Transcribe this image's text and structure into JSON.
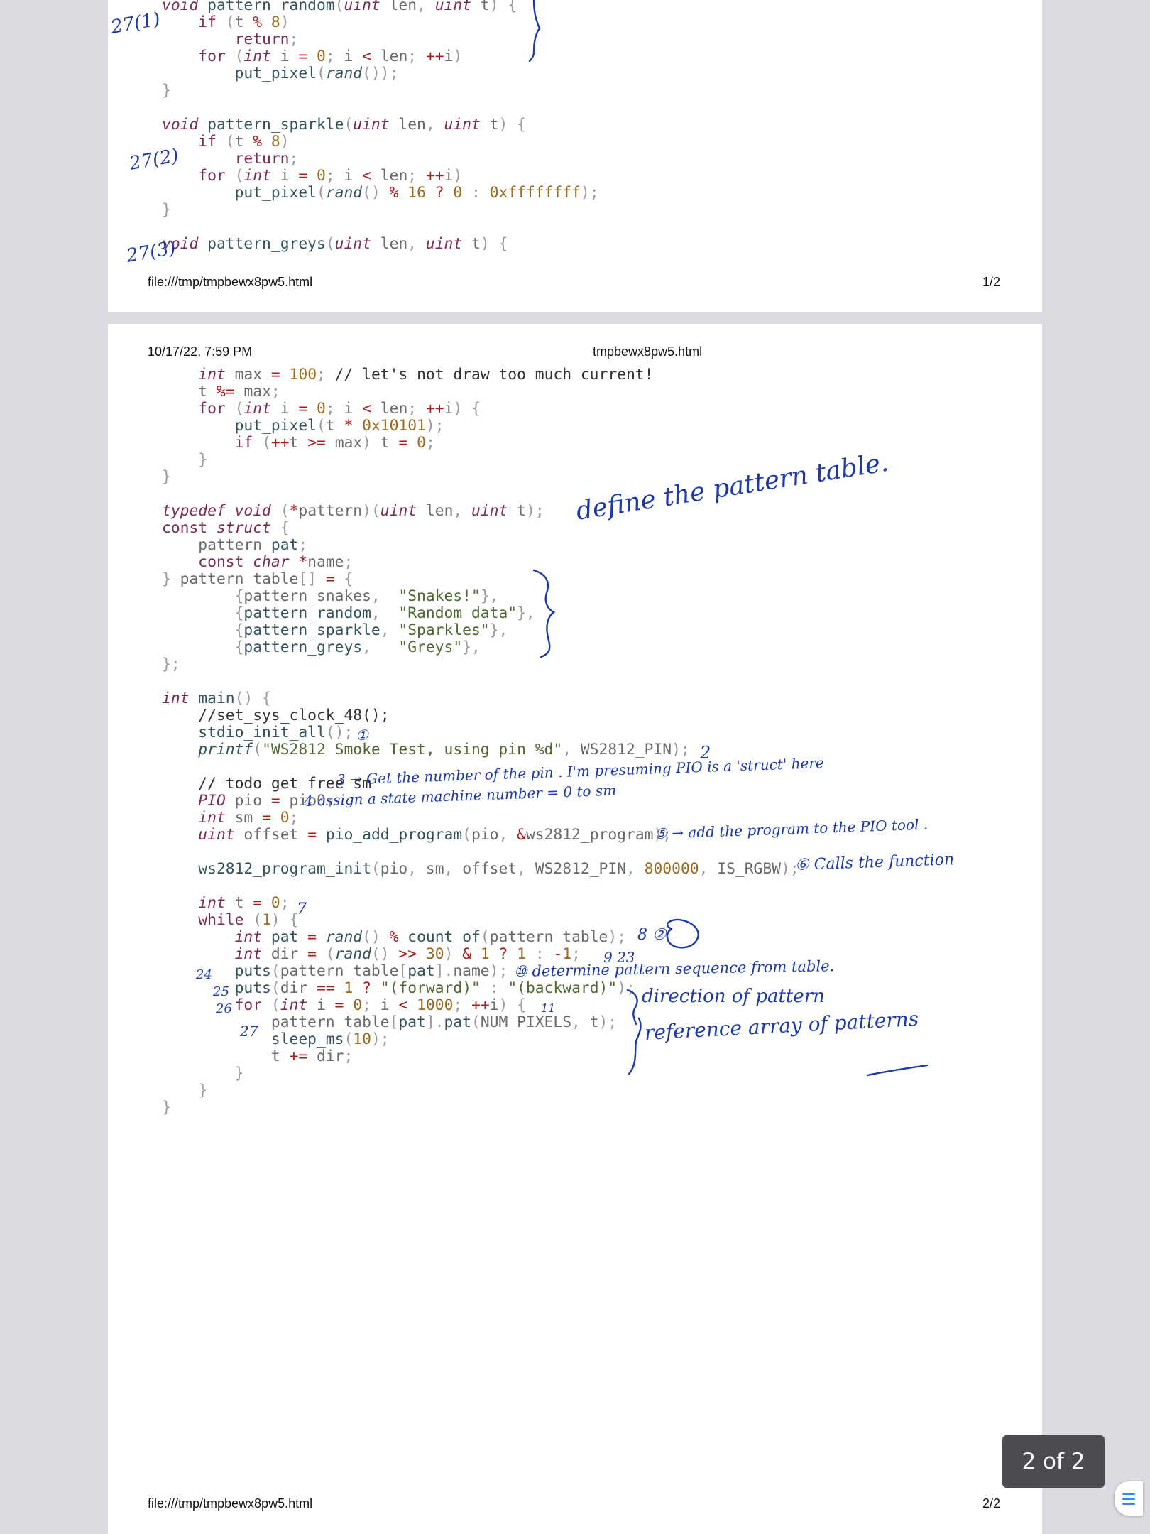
{
  "page1": {
    "footer_url": "file:///tmp/tmpbewx8pw5.html",
    "footer_page": "1/2"
  },
  "page2": {
    "header_date": "10/17/22, 7:59 PM",
    "header_title": "tmpbewx8pw5.html",
    "footer_url": "file:///tmp/tmpbewx8pw5.html",
    "footer_page": "2/2"
  },
  "code1": [
    "void pattern_random(uint len, uint t) {",
    "    if (t % 8)",
    "        return;",
    "    for (int i = 0; i < len; ++i)",
    "        put_pixel(rand());",
    "}",
    "",
    "void pattern_sparkle(uint len, uint t) {",
    "    if (t % 8)",
    "        return;",
    "    for (int i = 0; i < len; ++i)",
    "        put_pixel(rand() % 16 ? 0 : 0xffffffff);",
    "}",
    "",
    "void pattern_greys(uint len, uint t) {"
  ],
  "code2": [
    "    int max = 100; // let's not draw too much current!",
    "    t %= max;",
    "    for (int i = 0; i < len; ++i) {",
    "        put_pixel(t * 0x10101);",
    "        if (++t >= max) t = 0;",
    "    }",
    "}",
    "",
    "typedef void (*pattern)(uint len, uint t);",
    "const struct {",
    "    pattern pat;",
    "    const char *name;",
    "} pattern_table[] = {",
    "        {pattern_snakes,  \"Snakes!\"},",
    "        {pattern_random,  \"Random data\"},",
    "        {pattern_sparkle, \"Sparkles\"},",
    "        {pattern_greys,   \"Greys\"},",
    "};",
    "",
    "int main() {",
    "    //set_sys_clock_48();",
    "    stdio_init_all();",
    "    printf(\"WS2812 Smoke Test, using pin %d\", WS2812_PIN);",
    "",
    "    // todo get free sm",
    "    PIO pio = pio0;",
    "    int sm = 0;",
    "    uint offset = pio_add_program(pio, &ws2812_program);",
    "",
    "    ws2812_program_init(pio, sm, offset, WS2812_PIN, 800000, IS_RGBW);",
    "",
    "    int t = 0;",
    "    while (1) {",
    "        int pat = rand() % count_of(pattern_table);",
    "        int dir = (rand() >> 30) & 1 ? 1 : -1;",
    "        puts(pattern_table[pat].name);",
    "        puts(dir == 1 ? \"(forward)\" : \"(backward)\");",
    "        for (int i = 0; i < 1000; ++i) {",
    "            pattern_table[pat].pat(NUM_PIXELS, t);",
    "            sleep_ms(10);",
    "            t += dir;",
    "        }",
    "    }",
    "}"
  ],
  "annotations": {
    "a_27_1": "27(1)",
    "a_27_2": "27(2)",
    "a_27_3": "27(3)",
    "define_table": "define the pattern table.",
    "a_1": "①",
    "a_2": "2",
    "a_3": "3 → Get the number of the pin . I'm presuming PIO is a 'struct' here",
    "a_4": "4  assign a state machine number = 0 to sm",
    "a_5": "⑤ → add the program to the PIO tool .",
    "a_6": "⑥  Calls the function",
    "a_7": "7",
    "a_8": "8  ②",
    "a_9": "9  23",
    "a_10": "⑩  determine pattern sequence from table.",
    "a_direction": "direction of pattern",
    "a_reference": "reference array of patterns",
    "a_11": "11",
    "a_24": "24",
    "a_25": "25",
    "a_26": "26",
    "a_27": "27"
  },
  "viewer": {
    "page_indicator": "2 of 2",
    "menu_icon": "hamburger-menu-icon"
  },
  "colors": {
    "background": "#dbdbe1",
    "page": "#ffffff",
    "ink": "#1c3aa8",
    "keyword": "#7c2b52",
    "function": "#33545e",
    "number": "#9b6a1e",
    "string": "#4f6b32"
  }
}
